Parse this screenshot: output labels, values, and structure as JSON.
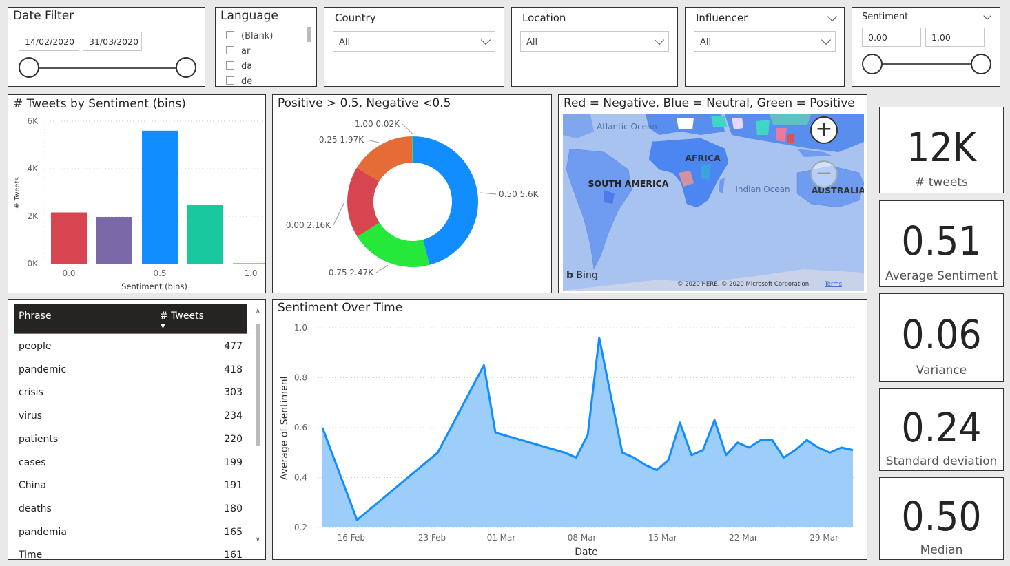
{
  "slicers": {
    "date_filter": {
      "title": "Date Filter",
      "start": "14/02/2020",
      "end": "31/03/2020"
    },
    "language": {
      "title": "Language",
      "items": [
        "(Blank)",
        "ar",
        "da",
        "de"
      ]
    },
    "country": {
      "title": "Country",
      "value": "All"
    },
    "location": {
      "title": "Location",
      "value": "All"
    },
    "influencer": {
      "title": "Influencer",
      "value": "All"
    },
    "sentiment": {
      "title": "Sentiment",
      "min": "0.00",
      "max": "1.00"
    }
  },
  "bar_chart": {
    "title": "# Tweets by Sentiment (bins)",
    "chart_data": {
      "type": "bar",
      "categories": [
        "0.0",
        "0.25",
        "0.5",
        "0.75",
        "1.0"
      ],
      "tick_labels": [
        "0.0",
        "",
        "0.5",
        "",
        "1.0"
      ],
      "values": [
        2160,
        1970,
        5600,
        2470,
        20
      ],
      "colors": [
        "#d64550",
        "#7a68a8",
        "#118dff",
        "#1ac8a0",
        "#3ed13e"
      ],
      "xlabel": "Sentiment (bins)",
      "ylabel": "# Tweets",
      "yticks": [
        "0K",
        "2K",
        "4K",
        "6K"
      ],
      "ylim": [
        0,
        6000
      ]
    }
  },
  "donut_chart": {
    "title": "Positive > 0.5, Negative <0.5",
    "chart_data": {
      "type": "pie",
      "slices": [
        {
          "label": "0.50 5.6K",
          "value": 5600,
          "color": "#118dff"
        },
        {
          "label": "0.75 2.47K",
          "value": 2470,
          "color": "#25e83a"
        },
        {
          "label": "0.00 2.16K",
          "value": 2160,
          "color": "#d64550"
        },
        {
          "label": "0.25 1.97K",
          "value": 1970,
          "color": "#e66c37"
        },
        {
          "label": "1.00 0.02K",
          "value": 20,
          "color": "#3ed13e"
        }
      ]
    }
  },
  "map": {
    "title": "Red = Negative, Blue = Neutral, Green = Positive",
    "labels": {
      "atlantic": "Atlantic Ocean",
      "africa": "AFRICA",
      "south_america": "SOUTH AMERICA",
      "indian": "Indian Ocean",
      "australia": "AUSTRALIA"
    },
    "attribution": "© 2020 HERE, © 2020 Microsoft Corporation",
    "terms": "Terms",
    "bing": "Bing"
  },
  "phrase_table": {
    "headers": [
      "Phrase",
      "# Tweets"
    ],
    "rows": [
      [
        "people",
        "477"
      ],
      [
        "pandemic",
        "418"
      ],
      [
        "crisis",
        "303"
      ],
      [
        "virus",
        "234"
      ],
      [
        "patients",
        "220"
      ],
      [
        "cases",
        "199"
      ],
      [
        "China",
        "191"
      ],
      [
        "deaths",
        "180"
      ],
      [
        "pandemia",
        "165"
      ],
      [
        "Time",
        "161"
      ]
    ]
  },
  "line_chart": {
    "title": "Sentiment Over Time",
    "chart_data": {
      "type": "area",
      "xlabel": "Date",
      "ylabel": "Average of Sentiment",
      "ylim": [
        0.2,
        1.0
      ],
      "yticks": [
        "0.2",
        "0.4",
        "0.6",
        "0.8",
        "1.0"
      ],
      "xticks": [
        {
          "day": 16,
          "label": "16 Feb"
        },
        {
          "day": 23,
          "label": "23 Feb"
        },
        {
          "day": 29,
          "label": "01 Mar"
        },
        {
          "day": 36,
          "label": "08 Mar"
        },
        {
          "day": 43,
          "label": "15 Mar"
        },
        {
          "day": 50,
          "label": "22 Mar"
        },
        {
          "day": 57,
          "label": "29 Mar"
        }
      ],
      "points": [
        [
          14,
          0.6
        ],
        [
          17,
          0.23
        ],
        [
          24,
          0.5
        ],
        [
          28,
          0.85
        ],
        [
          29,
          0.58
        ],
        [
          35,
          0.5
        ],
        [
          36,
          0.48
        ],
        [
          37,
          0.57
        ],
        [
          38,
          0.96
        ],
        [
          40,
          0.5
        ],
        [
          41,
          0.48
        ],
        [
          42,
          0.45
        ],
        [
          43,
          0.43
        ],
        [
          44,
          0.47
        ],
        [
          45,
          0.62
        ],
        [
          46,
          0.49
        ],
        [
          47,
          0.51
        ],
        [
          48,
          0.63
        ],
        [
          49,
          0.49
        ],
        [
          50,
          0.54
        ],
        [
          51,
          0.52
        ],
        [
          52,
          0.55
        ],
        [
          53,
          0.55
        ],
        [
          54,
          0.48
        ],
        [
          55,
          0.51
        ],
        [
          56,
          0.55
        ],
        [
          57,
          0.52
        ],
        [
          58,
          0.5
        ],
        [
          59,
          0.52
        ],
        [
          60,
          0.51
        ]
      ]
    }
  },
  "kpis": [
    {
      "value": "12K",
      "label": "# tweets"
    },
    {
      "value": "0.51",
      "label": "Average Sentiment"
    },
    {
      "value": "0.06",
      "label": "Variance"
    },
    {
      "value": "0.24",
      "label": "Standard deviation"
    },
    {
      "value": "0.50",
      "label": "Median"
    }
  ]
}
